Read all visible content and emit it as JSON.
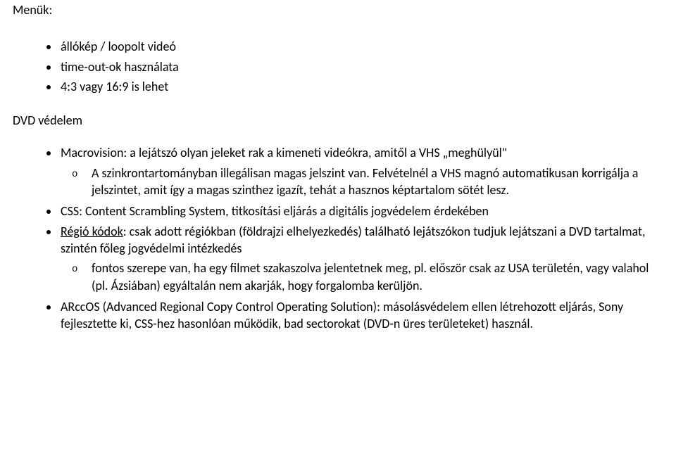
{
  "heading1": "Menük:",
  "list1": {
    "i0": "állókép / loopolt videó",
    "i1": "time-out-ok használata",
    "i2": "4:3 vagy 16:9 is lehet"
  },
  "heading2": "DVD védelem",
  "list2": {
    "i0": "Macrovision: a lejátszó olyan jeleket rak a kimeneti videókra, amitől a VHS „meghülyül\"",
    "i0_sub": {
      "s0": "A szinkrontartományban illegálisan magas jelszint van. Felvételnél a VHS magnó automatikusan korrigálja a jelszintet, amit így a magas szinthez igazít, tehát a hasznos képtartalom sötét lesz."
    },
    "i1": "CSS: Content Scrambling System, titkosítási eljárás a digitális jogvédelem érdekében",
    "i2_pre": "Régió kódok",
    "i2_post": ": csak adott régiókban (földrajzi elhelyezkedés) található lejátszókon tudjuk lejátszani a DVD tartalmat, szintén főleg jogvédelmi intézkedés",
    "i2_sub": {
      "s0": "fontos szerepe van, ha egy filmet szakaszolva jelentetnek meg, pl. először csak az USA területén, vagy valahol (pl. Ázsiában) egyáltalán nem akarják, hogy forgalomba kerüljön."
    },
    "i3": "ARccOS (Advanced Regional Copy Control Operating Solution): másolásvédelem ellen létrehozott eljárás, Sony fejlesztette ki, CSS-hez hasonlóan működik, bad sectorokat (DVD-n üres területeket) használ."
  }
}
